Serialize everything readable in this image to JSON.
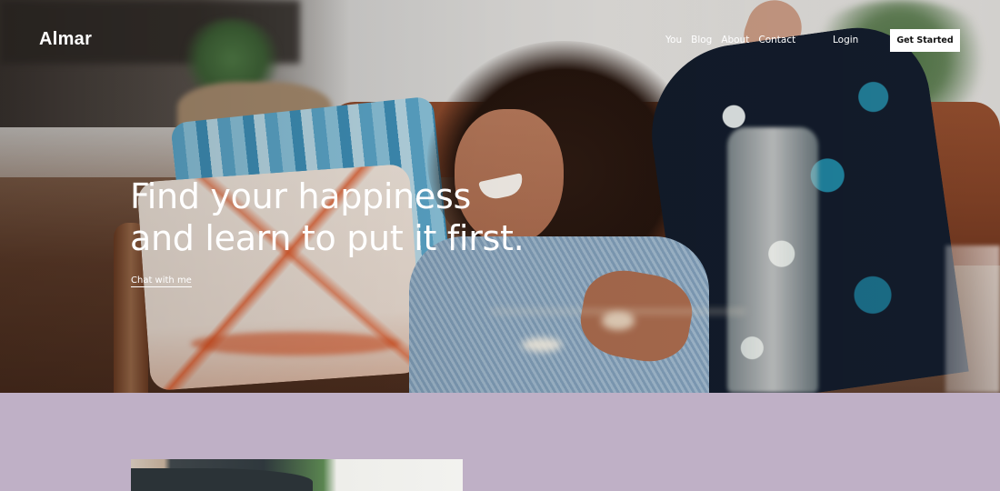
{
  "brand": {
    "name": "Almar"
  },
  "nav": {
    "items": [
      {
        "label": "You"
      },
      {
        "label": "Blog"
      },
      {
        "label": "About"
      },
      {
        "label": "Contact"
      }
    ],
    "login_label": "Login",
    "cta_label": "Get Started"
  },
  "hero": {
    "title_line_1": "Find your happiness",
    "title_line_2": "and learn to put it first.",
    "link_label": "Chat with me",
    "image_description": "Laughing woman with curly hair lounging on a brown sofa with pillows"
  },
  "lower_section": {
    "background_color": "#bfb0c6",
    "image_description": "Partially visible photo"
  },
  "colors": {
    "text_on_hero": "#ffffff",
    "cta_background": "#ffffff",
    "cta_text": "#111111",
    "section_background": "#bfb0c6"
  }
}
